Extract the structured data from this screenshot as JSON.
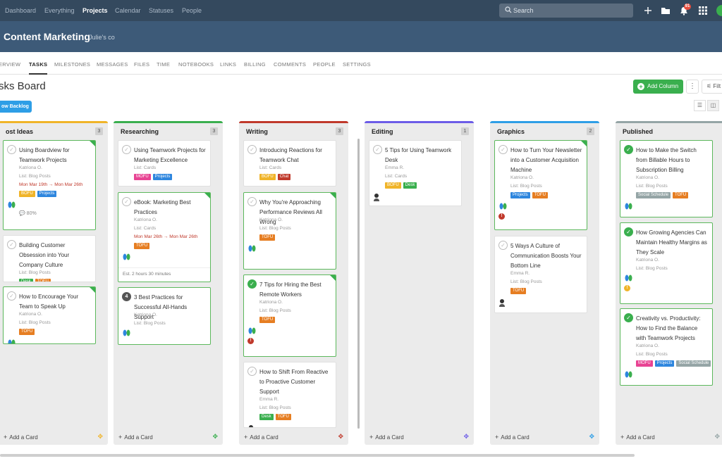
{
  "topnav": {
    "links": [
      "Dashboard",
      "Everything",
      "Projects",
      "Calendar",
      "Statuses",
      "People"
    ],
    "search_placeholder": "Search",
    "notification_count": "91"
  },
  "project": {
    "title": "Content Marketing",
    "company": "Julie's co"
  },
  "tabs": [
    "ERVIEW",
    "TASKS",
    "MILESTONES",
    "MESSAGES",
    "FILES",
    "TIME",
    "NOTEBOOKS",
    "LINKS",
    "BILLING",
    "COMMENTS",
    "PEOPLE",
    "SETTINGS"
  ],
  "page": {
    "title": "sks Board",
    "add_column": "Add Column",
    "filter": "Filt",
    "backlog": "ow Backlog"
  },
  "add_card_label": "Add a Card",
  "colors": {
    "green": "#3aaf4e",
    "orange": "#e67e22",
    "blue": "#2e86de",
    "yellow": "#f0b429",
    "red": "#c0392b",
    "pink": "#e84393",
    "gray": "#95a5a6",
    "bofu": "#f0b429"
  },
  "columns": [
    {
      "title": "ost Ideas",
      "count": "3",
      "bar": "#f0b429",
      "cards": [
        {
          "title": "Using Boardview for Teamwork Projects",
          "assignee": "Katriona O.",
          "list": "List: Blog Posts",
          "date": "Mon Mar 19th → Mon Mar 26th",
          "tags": [
            [
              "BOFU",
              "#f0b429"
            ],
            [
              "Projects",
              "#2e86de"
            ]
          ],
          "extra": "80%"
        },
        {
          "title": "Building Customer Obsession into Your Company Culture",
          "list": "List: Blog Posts",
          "tags": [
            [
              "Desk",
              "#3aaf4e"
            ],
            [
              "TOFU",
              "#e67e22"
            ]
          ]
        },
        {
          "title": "How to Encourage Your Team to Speak Up",
          "assignee": "Katriona O.",
          "list": "List: Blog Posts",
          "tags": [
            [
              "TOFU",
              "#e67e22"
            ]
          ]
        }
      ]
    },
    {
      "title": "Researching",
      "count": "3",
      "bar": "#3aaf4e",
      "cards": [
        {
          "title": "Using Teamwork Projects for Marketing Excellence",
          "list": "List: Cards",
          "tags": [
            [
              "MOFU",
              "#e84393"
            ],
            [
              "Projects",
              "#2e86de"
            ]
          ]
        },
        {
          "title": "eBook: Marketing Best Practices",
          "assignee": "Katriona O.",
          "list": "List: Cards",
          "date": "Mon Mar 26th → Mon Mar 26th",
          "tags": [
            [
              "TOFU",
              "#e67e22"
            ]
          ],
          "est": "Est. 2 hours 30 minutes"
        },
        {
          "title": "3 Best Practices for Successful All-Hands Support",
          "assignee": "Katriona O.",
          "list": "List: Blog Posts",
          "num": "4"
        }
      ]
    },
    {
      "title": "Writing",
      "count": "3",
      "bar": "#c0392b",
      "cards": [
        {
          "title": "Introducing Reactions for Teamwork Chat",
          "list": "List: Cards",
          "tags": [
            [
              "BOFU",
              "#f0b429"
            ],
            [
              "Chat",
              "#c0392b"
            ]
          ]
        },
        {
          "title": "Why You're Approaching Performance Reviews All Wrong",
          "assignee": "Katriona O.",
          "list": "List: Blog Posts",
          "tags": [
            [
              "TOFU",
              "#e67e22"
            ]
          ]
        },
        {
          "title": "7 Tips for Hiring the Best Remote Workers",
          "assignee": "Katriona O.",
          "list": "List: Blog Posts",
          "tags": [
            [
              "TOFU",
              "#e67e22"
            ]
          ]
        },
        {
          "title": "How to Shift From Reactive to Proactive Customer Support",
          "assignee": "Emma R.",
          "list": "List: Blog Posts",
          "tags": [
            [
              "Desk",
              "#3aaf4e"
            ],
            [
              "TOFU",
              "#e67e22"
            ]
          ]
        }
      ]
    },
    {
      "title": "Editing",
      "count": "1",
      "bar": "#6c5ce7",
      "cards": [
        {
          "title": "5 Tips for Using Teamwork Desk",
          "assignee": "Emma R.",
          "list": "List: Cards",
          "tags": [
            [
              "BOFU",
              "#f0b429"
            ],
            [
              "Desk",
              "#3aaf4e"
            ]
          ]
        }
      ]
    },
    {
      "title": "Graphics",
      "count": "2",
      "bar": "#2e9ee6",
      "cards": [
        {
          "title": "How to Turn Your Newsletter into a Customer Acquisition Machine",
          "assignee": "Katriona O.",
          "list": "List: Blog Posts",
          "tags": [
            [
              "Projects",
              "#2e86de"
            ],
            [
              "TOFU",
              "#e67e22"
            ]
          ]
        },
        {
          "title": "5 Ways A Culture of Communication Boosts Your Bottom Line",
          "assignee": "Emma R.",
          "list": "List: Blog Posts",
          "tags": [
            [
              "TOFU",
              "#e67e22"
            ]
          ]
        }
      ]
    },
    {
      "title": "Published",
      "count": "",
      "bar": "#95a5a6",
      "cards": [
        {
          "title": "How to Make the Switch from Billable Hours to Subscription Billing",
          "assignee": "Katriona O.",
          "list": "List: Blog Posts",
          "tags": [
            [
              "Social Schedule",
              "#95a5a6"
            ],
            [
              "TOFU",
              "#e67e22"
            ]
          ]
        },
        {
          "title": "How Growing Agencies Can Maintain Healthy Margins as They Scale",
          "assignee": "Katriona O.",
          "list": "List: Blog Posts"
        },
        {
          "title": "Creativity vs. Productivity: How to Find the Balance with Teamwork Projects",
          "assignee": "Katriona O.",
          "list": "List: Blog Posts",
          "tags": [
            [
              "MOFU",
              "#e84393"
            ],
            [
              "Projects",
              "#2e86de"
            ],
            [
              "Social Schedule",
              "#95a5a6"
            ]
          ]
        }
      ]
    }
  ]
}
